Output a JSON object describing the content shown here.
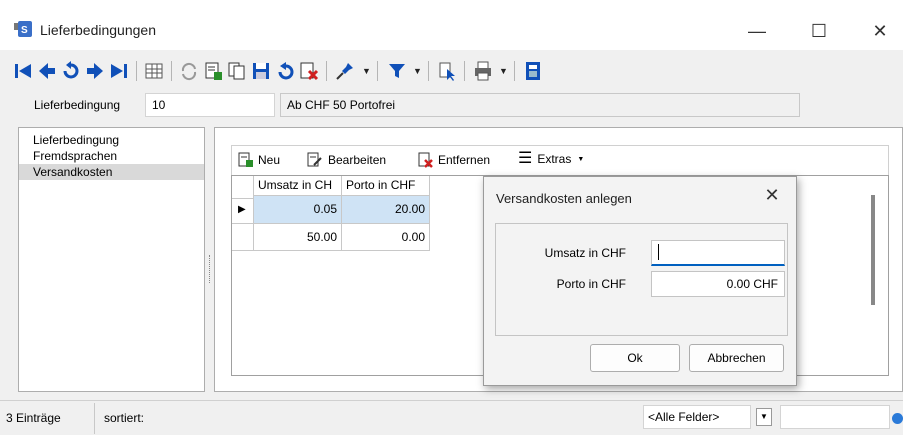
{
  "window": {
    "title": "Lieferbedingungen",
    "minimize": "—",
    "maximize": "☐",
    "close": "✕"
  },
  "header": {
    "label": "Lieferbedingung",
    "code": "10",
    "description": "Ab CHF 50 Portofrei"
  },
  "nav": {
    "items": [
      "Lieferbedingung",
      "Fremdsprachen",
      "Versandkosten"
    ]
  },
  "subtoolbar": {
    "neu": "Neu",
    "bearbeiten": "Bearbeiten",
    "entfernen": "Entfernen",
    "extras": "Extras"
  },
  "grid": {
    "columns": [
      "Umsatz in CH",
      "Porto in CHF"
    ],
    "rows": [
      [
        "0.05",
        "20.00"
      ],
      [
        "50.00",
        "0.00"
      ]
    ]
  },
  "dialog": {
    "title": "Versandkosten anlegen",
    "umsatz_label": "Umsatz in CHF",
    "umsatz_value": "",
    "porto_label": "Porto in CHF",
    "porto_value": "0.00 CHF",
    "ok": "Ok",
    "cancel": "Abbrechen"
  },
  "status": {
    "count": "3 Einträge",
    "sorted": "sortiert:",
    "filter_field": "<Alle Felder>"
  },
  "colors": {
    "accent": "#0060c0",
    "selection": "#cfe3f5",
    "nav_selected": "#d9d9d9"
  }
}
